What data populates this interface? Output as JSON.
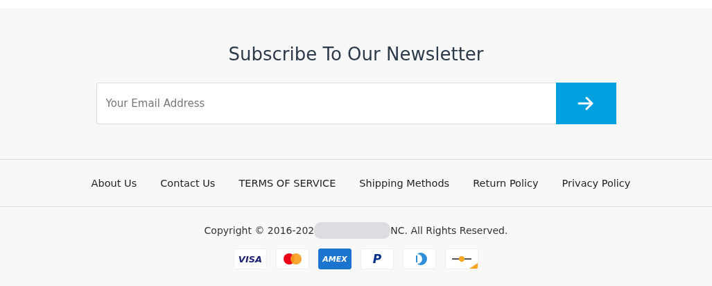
{
  "newsletter": {
    "title": "Subscribe To Our Newsletter",
    "email_field": {
      "placeholder": "Your Email Address"
    }
  },
  "footer_links": [
    "About Us",
    "Contact Us",
    "TERMS OF SERVICE",
    "Shipping Methods",
    "Return Policy",
    "Privacy Policy"
  ],
  "copyright": {
    "before": "Copyright © 2016-202",
    "after": "NC. All Rights Reserved."
  },
  "payment_icons": [
    {
      "kind": "visa",
      "label": "VISA"
    },
    {
      "kind": "mastercard"
    },
    {
      "kind": "amex",
      "label": "AMEX"
    },
    {
      "kind": "paypal",
      "label": "P"
    },
    {
      "kind": "diners"
    },
    {
      "kind": "generic"
    }
  ]
}
